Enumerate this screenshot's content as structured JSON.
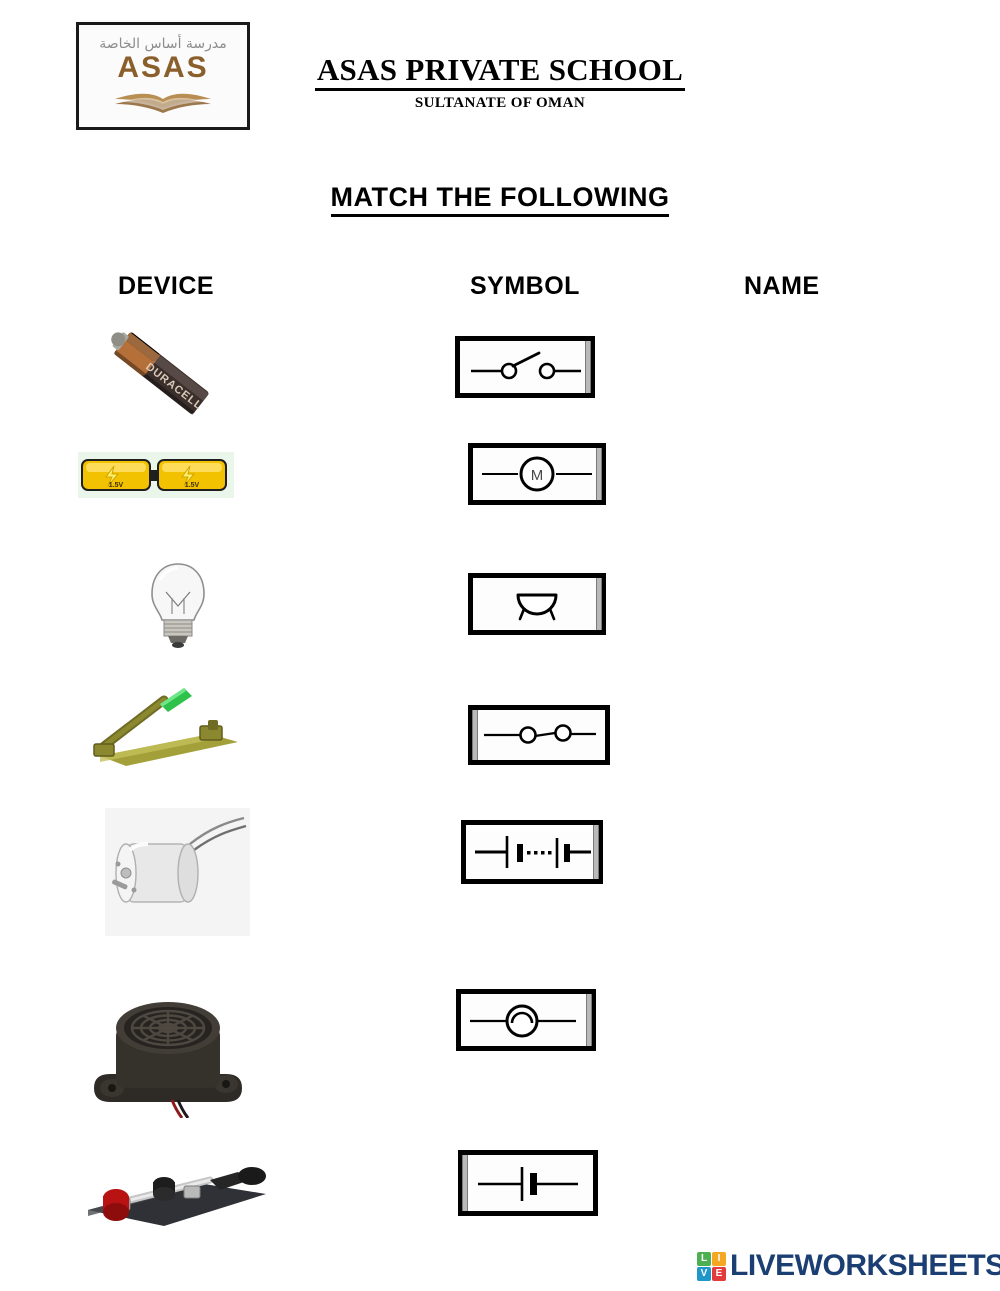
{
  "header": {
    "logo": {
      "arabic_line": "مدرسة أساس الخاصة",
      "word": "ASAS",
      "book_icon": "open-book-icon"
    },
    "school_title": "ASAS PRIVATE SCHOOL",
    "school_subtitle": "SULTANATE OF OMAN"
  },
  "worksheet": {
    "instruction": "MATCH THE FOLLOWING",
    "columns": {
      "device": "DEVICE",
      "symbol": "SYMBOL",
      "name": "NAME"
    }
  },
  "devices": [
    {
      "icon": "aa-battery-cell-photo",
      "label": "cell"
    },
    {
      "icon": "two-cell-battery-photo",
      "label": "battery"
    },
    {
      "icon": "light-bulb-photo",
      "label": "lamp"
    },
    {
      "icon": "open-knife-switch-photo",
      "label": "open switch"
    },
    {
      "icon": "dc-motor-photo",
      "label": "motor"
    },
    {
      "icon": "buzzer-photo",
      "label": "buzzer"
    },
    {
      "icon": "closed-lab-switch-photo",
      "label": "closed switch"
    }
  ],
  "symbols": [
    {
      "icon": "open-switch-symbol",
      "label": "open switch"
    },
    {
      "icon": "motor-symbol",
      "label": "motor"
    },
    {
      "icon": "buzzer-symbol",
      "label": "buzzer"
    },
    {
      "icon": "closed-switch-symbol",
      "label": "closed switch"
    },
    {
      "icon": "battery-symbol",
      "label": "battery"
    },
    {
      "icon": "lamp-symbol",
      "label": "lamp"
    },
    {
      "icon": "cell-symbol",
      "label": "cell"
    }
  ],
  "names_column": {
    "entries": [
      "",
      "",
      "",
      "",
      "",
      "",
      ""
    ]
  },
  "footer": {
    "brand": "LIVEWORKSHEETS",
    "tiles": [
      {
        "letter": "L",
        "color": "#4caf50"
      },
      {
        "letter": "I",
        "color": "#f5a623"
      },
      {
        "letter": "V",
        "color": "#2196c9"
      },
      {
        "letter": "E",
        "color": "#e23b3b"
      }
    ],
    "brand_color": "#1b3f73"
  }
}
